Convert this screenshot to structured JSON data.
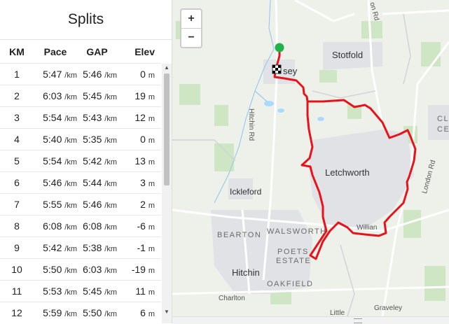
{
  "splits": {
    "title": "Splits",
    "headers": {
      "km": "KM",
      "pace": "Pace",
      "gap": "GAP",
      "elev": "Elev"
    },
    "rows": [
      {
        "km": "1",
        "pace": "5:47",
        "pace_unit": "/km",
        "gap": "5:46",
        "gap_unit": "/km",
        "elev": "0",
        "elev_unit": "m"
      },
      {
        "km": "2",
        "pace": "6:03",
        "pace_unit": "/km",
        "gap": "5:45",
        "gap_unit": "/km",
        "elev": "19",
        "elev_unit": "m"
      },
      {
        "km": "3",
        "pace": "5:54",
        "pace_unit": "/km",
        "gap": "5:43",
        "gap_unit": "/km",
        "elev": "12",
        "elev_unit": "m"
      },
      {
        "km": "4",
        "pace": "5:40",
        "pace_unit": "/km",
        "gap": "5:35",
        "gap_unit": "/km",
        "elev": "0",
        "elev_unit": "m"
      },
      {
        "km": "5",
        "pace": "5:54",
        "pace_unit": "/km",
        "gap": "5:42",
        "gap_unit": "/km",
        "elev": "13",
        "elev_unit": "m"
      },
      {
        "km": "6",
        "pace": "5:46",
        "pace_unit": "/km",
        "gap": "5:44",
        "gap_unit": "/km",
        "elev": "3",
        "elev_unit": "m"
      },
      {
        "km": "7",
        "pace": "5:55",
        "pace_unit": "/km",
        "gap": "5:46",
        "gap_unit": "/km",
        "elev": "2",
        "elev_unit": "m"
      },
      {
        "km": "8",
        "pace": "6:08",
        "pace_unit": "/km",
        "gap": "6:08",
        "gap_unit": "/km",
        "elev": "-6",
        "elev_unit": "m"
      },
      {
        "km": "9",
        "pace": "5:42",
        "pace_unit": "/km",
        "gap": "5:38",
        "gap_unit": "/km",
        "elev": "-1",
        "elev_unit": "m"
      },
      {
        "km": "10",
        "pace": "5:50",
        "pace_unit": "/km",
        "gap": "6:03",
        "gap_unit": "/km",
        "elev": "-19",
        "elev_unit": "m"
      },
      {
        "km": "11",
        "pace": "5:53",
        "pace_unit": "/km",
        "gap": "5:45",
        "gap_unit": "/km",
        "elev": "11",
        "elev_unit": "m"
      },
      {
        "km": "12",
        "pace": "5:59",
        "pace_unit": "/km",
        "gap": "5:50",
        "gap_unit": "/km",
        "elev": "6",
        "elev_unit": "m"
      }
    ]
  },
  "map": {
    "zoom_in": "+",
    "zoom_out": "−",
    "labels": {
      "stotfold": "Stotfold",
      "arlesey": "sey",
      "letchworth": "Letchworth",
      "ickleford": "Ickleford",
      "bearton": "BEARTON",
      "walsworth": "WALSWORTH",
      "poets": "POETS",
      "estate": "ESTATE",
      "hitchin": "Hitchin",
      "oakfield": "OAKFIELD",
      "willian": "Willian",
      "charlton": "Charlton",
      "little": "Little",
      "graveley": "Graveley",
      "hitchin_rd": "Hitchin Rd",
      "london_rd": "London Rd",
      "top_rd": "on Rd",
      "clo": "CLO",
      "ce": "CE"
    },
    "route_color": "#e8121a",
    "start_color": "#22b14c"
  }
}
